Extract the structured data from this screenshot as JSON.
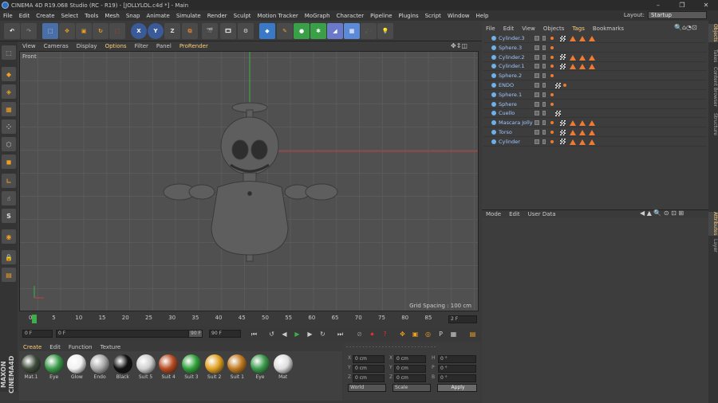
{
  "window": {
    "title": "CINEMA 4D R19.068 Studio (RC - R19) - [JOLLYLOL.c4d *] - Main",
    "buttons": [
      "–",
      "❐",
      "✕"
    ]
  },
  "menu": {
    "items": [
      "File",
      "Edit",
      "Create",
      "Select",
      "Tools",
      "Mesh",
      "Snap",
      "Animate",
      "Simulate",
      "Render",
      "Sculpt",
      "Motion Tracker",
      "MoGraph",
      "Character",
      "Pipeline",
      "Plugins",
      "Script",
      "Window",
      "Help"
    ],
    "layout_label": "Layout:",
    "layout_value": "Startup"
  },
  "viewport": {
    "menu": [
      "View",
      "Cameras",
      "Display",
      "Options",
      "Filter",
      "Panel",
      "ProRender"
    ],
    "label": "Front",
    "grid_spacing": "Grid Spacing : 100 cm"
  },
  "timeline": {
    "ticks": [
      "0",
      "5",
      "10",
      "15",
      "20",
      "25",
      "30",
      "35",
      "40",
      "45",
      "50",
      "55",
      "60",
      "65",
      "70",
      "75",
      "80",
      "85",
      "90"
    ],
    "end_frame": "2 F",
    "current_frame": "0 F",
    "start_field": "0 F",
    "end_field": "90 F",
    "max_field": "90 F"
  },
  "materials": {
    "menu": [
      "Create",
      "Edit",
      "Function",
      "Texture"
    ],
    "items": [
      {
        "name": "Mat.1",
        "color": "#3e4a3a"
      },
      {
        "name": "Eye",
        "color": "#3a9a4a"
      },
      {
        "name": "Glow",
        "color": "#f0f0f0"
      },
      {
        "name": "Endo",
        "color": "#a8a8a8"
      },
      {
        "name": "Black",
        "color": "#111111"
      },
      {
        "name": "Suit 5",
        "color": "#cfcfcf"
      },
      {
        "name": "Suit 4",
        "color": "#b84a20"
      },
      {
        "name": "Suit 3",
        "color": "#2fa03a"
      },
      {
        "name": "Suit 2",
        "color": "#e0a020"
      },
      {
        "name": "Suit 1",
        "color": "#c07a20"
      },
      {
        "name": "Eye",
        "color": "#3a9a4a"
      },
      {
        "name": "Mat",
        "color": "#dddddd"
      }
    ]
  },
  "coords": {
    "rows": [
      [
        "X",
        "0 cm",
        "X",
        "0 cm",
        "H",
        "0 °"
      ],
      [
        "Y",
        "0 cm",
        "Y",
        "0 cm",
        "P",
        "0 °"
      ],
      [
        "Z",
        "0 cm",
        "Z",
        "0 cm",
        "B",
        "0 °"
      ]
    ],
    "mode": "World",
    "scale": "Scale",
    "apply": "Apply"
  },
  "objects": {
    "menu": [
      "File",
      "Edit",
      "View",
      "Objects",
      "Tags",
      "Bookmarks"
    ],
    "rows": [
      {
        "name": "Cylinder.3",
        "tags": "full"
      },
      {
        "name": "Sphere.3",
        "tags": "dot"
      },
      {
        "name": "Cylinder.2",
        "tags": "full"
      },
      {
        "name": "Cylinder.1",
        "tags": "full"
      },
      {
        "name": "Sphere.2",
        "tags": "dot"
      },
      {
        "name": "ENDO",
        "tags": "chk"
      },
      {
        "name": "Sphere.1",
        "tags": "dot"
      },
      {
        "name": "Sphere",
        "tags": "dot"
      },
      {
        "name": "Cuello",
        "tags": "chkonly"
      },
      {
        "name": "Mascara Jolly",
        "tags": "full"
      },
      {
        "name": "Torso",
        "tags": "full"
      },
      {
        "name": "Cylinder",
        "tags": "full"
      }
    ]
  },
  "attributes": {
    "menu": [
      "Mode",
      "Edit",
      "User Data"
    ]
  },
  "sidetabs": [
    "Objects",
    "Takes",
    "Content Browser",
    "Structure",
    "Attributes",
    "Layer"
  ]
}
